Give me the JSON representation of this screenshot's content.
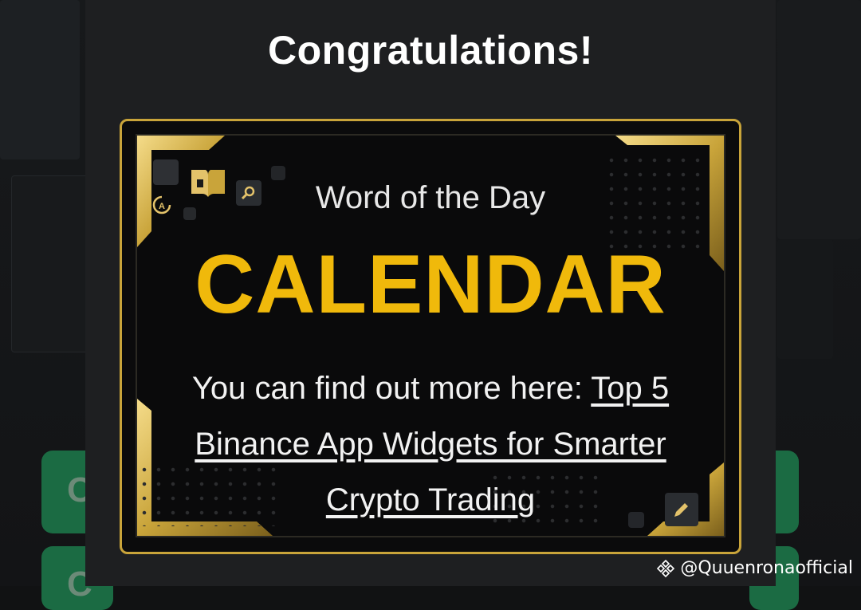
{
  "dialog": {
    "title": "Congratulations!"
  },
  "card": {
    "label": "Word of the Day",
    "word": "CALENDAR",
    "more_prefix": "You can find out more here: ",
    "link_text": "Top 5 Binance App Widgets for Smarter Crypto Trading",
    "icons": [
      "book-icon",
      "search-icon",
      "translate-icon",
      "pencil-icon"
    ]
  },
  "background": {
    "button_letter_1": "C",
    "button_letter_2": "C"
  },
  "watermark": {
    "text": "@Quuenronaofficial",
    "icon": "binance-logo-icon"
  },
  "colors": {
    "accent_gold": "#f0b90b",
    "frame_gold": "#c9a43a",
    "modal_bg": "#1e1f21",
    "green_button": "#1b6b43"
  }
}
